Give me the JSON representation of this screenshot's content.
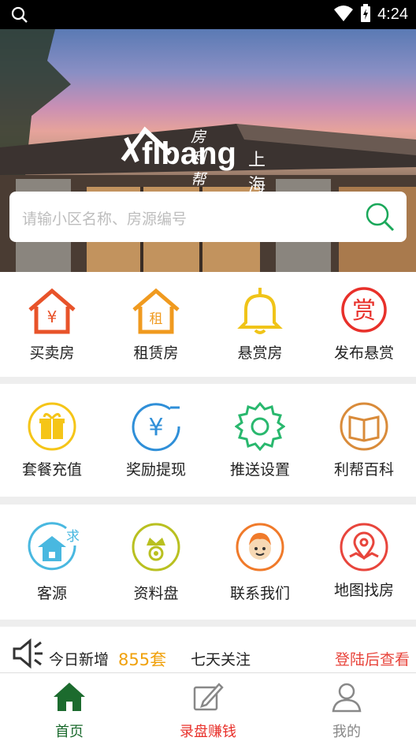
{
  "status_bar": {
    "time": "4:24"
  },
  "hero": {
    "logo": {
      "brand": "flbang",
      "chinese_name": "房利帮",
      "city": "上海"
    },
    "search": {
      "placeholder": "请输小区名称、房源编号"
    }
  },
  "grid": {
    "row1": [
      {
        "label": "买卖房",
        "icon": "house-yuan-icon",
        "color": "#e8532a"
      },
      {
        "label": "租赁房",
        "icon": "house-rent-icon",
        "color": "#f09a1f"
      },
      {
        "label": "悬赏房",
        "icon": "bell-icon",
        "color": "#f0c419"
      },
      {
        "label": "发布悬赏",
        "icon": "reward-stamp-icon",
        "color": "#e8302a"
      }
    ],
    "row2": [
      {
        "label": "套餐充值",
        "icon": "gift-icon",
        "color": "#f5c518"
      },
      {
        "label": "奖励提现",
        "icon": "yuan-withdraw-icon",
        "color": "#2f8fd8"
      },
      {
        "label": "推送设置",
        "icon": "gear-icon",
        "color": "#29b86e"
      },
      {
        "label": "利帮百科",
        "icon": "book-icon",
        "color": "#d98b3a"
      }
    ],
    "row3": [
      {
        "label": "客源",
        "icon": "client-request-icon",
        "color": "#49b8e0",
        "badge": "求"
      },
      {
        "label": "资料盘",
        "icon": "crown-icon",
        "color": "#b9c020"
      },
      {
        "label": "联系我们",
        "icon": "contact-face-icon",
        "color": "#f07a2a"
      },
      {
        "label": "地图找房",
        "icon": "map-pin-icon",
        "color": "#e8453c"
      }
    ]
  },
  "newsbar": {
    "today_label": "今日新增",
    "today_count": "855套",
    "seven_day_label": "七天关注",
    "login_link": "登陆后查看"
  },
  "bottom_nav": [
    {
      "label": "首页",
      "icon": "home-icon",
      "color": "#1c6b2e",
      "active": true
    },
    {
      "label": "录盘赚钱",
      "icon": "edit-pen-icon",
      "color": "#e8302a",
      "active": false
    },
    {
      "label": "我的",
      "icon": "user-icon",
      "color": "#888888",
      "active": false
    }
  ]
}
